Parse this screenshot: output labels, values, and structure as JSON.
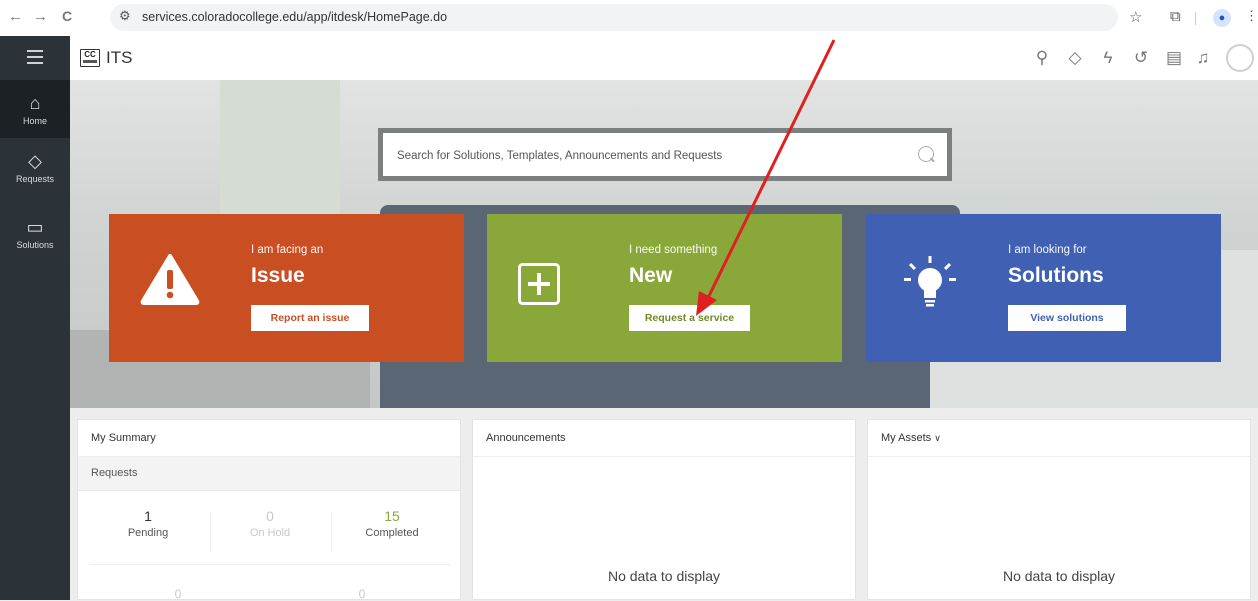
{
  "browser": {
    "url": "services.coloradocollege.edu/app/itdesk/HomePage.do",
    "back": "←",
    "forward": "→",
    "reload": "C"
  },
  "header": {
    "logo_text": "CC",
    "title": "ITS"
  },
  "sidebar": {
    "items": [
      {
        "label": "Home",
        "icon": "home-icon"
      },
      {
        "label": "Requests",
        "icon": "diamond-icon"
      },
      {
        "label": "Solutions",
        "icon": "book-icon"
      }
    ]
  },
  "search": {
    "placeholder": "Search for Solutions, Templates, Announcements and Requests"
  },
  "cards": [
    {
      "kicker": "I am facing an",
      "title": "Issue",
      "button": "Report an issue",
      "color": "#c94f22",
      "icon": "warning-icon"
    },
    {
      "kicker": "I need something",
      "title": "New",
      "button": "Request a service",
      "color": "#8aa83a",
      "icon": "plus-icon"
    },
    {
      "kicker": "I am looking for",
      "title": "Solutions",
      "button": "View solutions",
      "color": "#3f60b3",
      "icon": "lightbulb-icon"
    }
  ],
  "summary": {
    "title": "My Summary",
    "section": "Requests",
    "stats": [
      {
        "value": "1",
        "label": "Pending",
        "color": "#333"
      },
      {
        "value": "0",
        "label": "On Hold",
        "color": "#c8c8c8"
      },
      {
        "value": "15",
        "label": "Completed",
        "color": "#8aa83a"
      }
    ],
    "row2": [
      "0",
      "0"
    ]
  },
  "announcements": {
    "title": "Announcements",
    "empty": "No data to display"
  },
  "assets": {
    "title": "My Assets",
    "empty": "No data to display"
  },
  "annotation": {
    "arrow_color": "#e02020"
  }
}
